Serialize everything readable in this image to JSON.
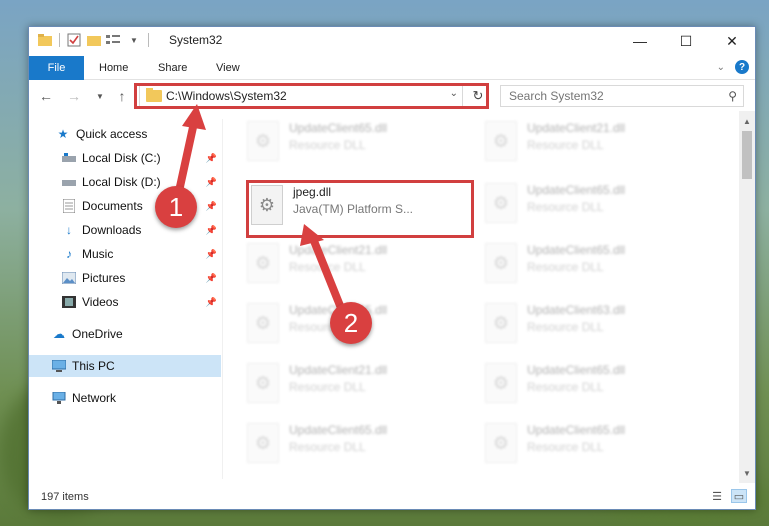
{
  "window": {
    "title": "System32",
    "controls": {
      "minimize": "—",
      "maximize": "☐",
      "close": "✕"
    }
  },
  "ribbon": {
    "tabs": [
      "File",
      "Home",
      "Share",
      "View"
    ],
    "help": "?"
  },
  "address": {
    "path": "C:\\Windows\\System32",
    "search_placeholder": "Search System32"
  },
  "nav": {
    "quick_access": "Quick access",
    "items": [
      {
        "label": "Local Disk (C:)",
        "icon": "drive-icon"
      },
      {
        "label": "Local Disk (D:)",
        "icon": "drive-icon"
      },
      {
        "label": "Documents",
        "icon": "documents-icon"
      },
      {
        "label": "Downloads",
        "icon": "downloads-icon"
      },
      {
        "label": "Music",
        "icon": "music-icon"
      },
      {
        "label": "Pictures",
        "icon": "pictures-icon"
      },
      {
        "label": "Videos",
        "icon": "videos-icon"
      }
    ],
    "onedrive": "OneDrive",
    "this_pc": "This PC",
    "network": "Network"
  },
  "files": {
    "left": [
      {
        "name": "UpdateClient65.dll",
        "desc": "Resource DLL"
      },
      {
        "name": "jpeg.dll",
        "desc": "Java(TM) Platform S..."
      },
      {
        "name": "UpdateClient21.dll",
        "desc": "Resource DLL"
      },
      {
        "name": "UpdateClient65.dll",
        "desc": "Resource DLL"
      },
      {
        "name": "UpdateClient21.dll",
        "desc": "Resource DLL"
      },
      {
        "name": "UpdateClient65.dll",
        "desc": "Resource DLL"
      }
    ],
    "right": [
      {
        "name": "UpdateClient21.dll",
        "desc": "Resource DLL"
      },
      {
        "name": "UpdateClient65.dll",
        "desc": "Resource DLL"
      },
      {
        "name": "UpdateClient65.dll",
        "desc": "Resource DLL"
      },
      {
        "name": "UpdateClient63.dll",
        "desc": "Resource DLL"
      },
      {
        "name": "UpdateClient65.dll",
        "desc": "Resource DLL"
      },
      {
        "name": "UpdateClient65.dll",
        "desc": "Resource DLL"
      }
    ]
  },
  "status": {
    "item_count": "197 items"
  },
  "callouts": {
    "one": "1",
    "two": "2"
  },
  "colors": {
    "accent": "#1979ca",
    "highlight": "#d13f3f",
    "selection": "#cce4f7"
  }
}
